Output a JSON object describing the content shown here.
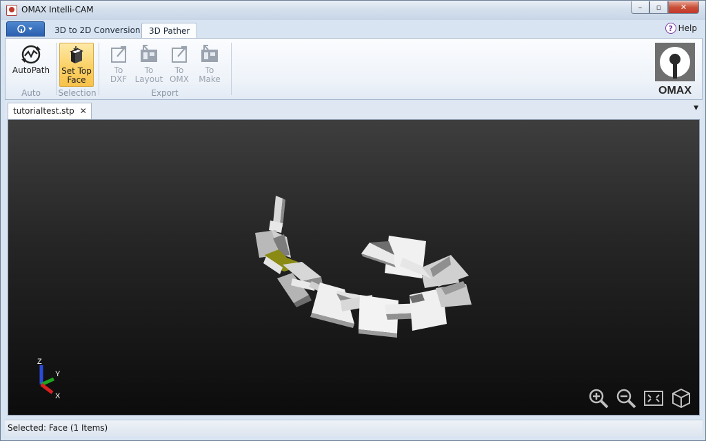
{
  "window": {
    "title": "OMAX Intelli-CAM"
  },
  "window_controls": {
    "minimize": "–",
    "maximize": "▫",
    "close": "✕"
  },
  "ribbon_tabs": [
    {
      "label": "3D to 2D Conversion"
    },
    {
      "label": "3D Pather"
    }
  ],
  "help": {
    "label": "Help",
    "icon": "?"
  },
  "ribbon": {
    "groups": [
      {
        "label": "Auto",
        "buttons": [
          {
            "label": "AutoPath"
          }
        ]
      },
      {
        "label": "Selection",
        "buttons": [
          {
            "line1": "Set Top",
            "line2": "Face"
          }
        ]
      },
      {
        "label": "Export",
        "buttons": [
          {
            "line1": "To",
            "line2": "DXF"
          },
          {
            "line1": "To",
            "line2": "Layout"
          },
          {
            "line1": "To",
            "line2": "OMX"
          },
          {
            "line1": "To",
            "line2": "Make"
          }
        ]
      }
    ],
    "logo_text": "OMAX"
  },
  "document": {
    "tab_label": "tutorialtest.stp",
    "close_glyph": "✕",
    "dropdown_glyph": "▼"
  },
  "triad": {
    "z": "Z",
    "y": "Y",
    "x": "X"
  },
  "status": {
    "text": "Selected: Face (1 Items)"
  },
  "colors": {
    "accent": "#2b5fae",
    "selected_face": "#8b8a14",
    "viewport_bg": "#1a1a1a"
  }
}
